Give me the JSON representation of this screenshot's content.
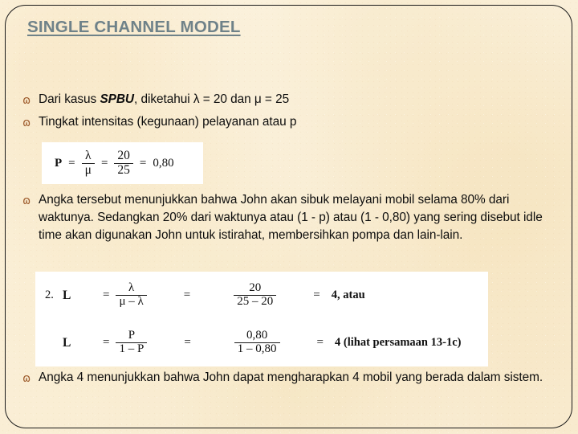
{
  "slide": {
    "title": "SINGLE CHANNEL MODEL",
    "title_color": "#6f8289",
    "background_color": "#faf0da",
    "frame_color": "#1a1a1a",
    "bullet_glyph": "ɷ",
    "bullet_color": "#9d5a2a"
  },
  "bullets": [
    {
      "id": "bullet-lambda-mu",
      "pre": "Dari kasus ",
      "emphasis": "SPBU",
      "post": ", diketahui λ = 20 dan μ = 25"
    },
    {
      "id": "bullet-intensitas",
      "text": "Tingkat intensitas (kegunaan) pelayanan atau p"
    },
    {
      "id": "bullet-penjelasan",
      "text": "Angka tersebut menunjukkan bahwa John akan sibuk melayani mobil selama 80% dari waktunya. Sedangkan 20% dari waktunya atau (1 - p) atau (1 - 0,80) yang sering disebut idle time akan digunakan John untuk istirahat, membersihkan pompa dan lain-lain."
    },
    {
      "id": "bullet-kesimpulan",
      "text": "Angka 4 menunjukkan bahwa John dapat mengharapkan 4 mobil yang berada dalam sistem."
    }
  ],
  "formula_1": {
    "label": "P",
    "eq1": "=",
    "frac1_num": "λ",
    "frac1_den": "μ",
    "eq2": "=",
    "frac2_num": "20",
    "frac2_den": "25",
    "eq3": "=",
    "result": "0,80"
  },
  "formula_2": {
    "line1": {
      "number": "2.",
      "label": "L",
      "eq1": "=",
      "frac1_num": "λ",
      "frac1_den": "μ – λ",
      "eq2": "=",
      "frac2_num": "20",
      "frac2_den": "25 – 20",
      "eq3": "=",
      "result": "4, atau"
    },
    "line2": {
      "label": "L",
      "eq1": "=",
      "frac1_num": "P",
      "frac1_den": "1 – P",
      "eq2": "=",
      "frac2_num": "0,80",
      "frac2_den": "1 – 0,80",
      "eq3": "=",
      "result": "4 (lihat persamaan 13-1c)"
    }
  }
}
